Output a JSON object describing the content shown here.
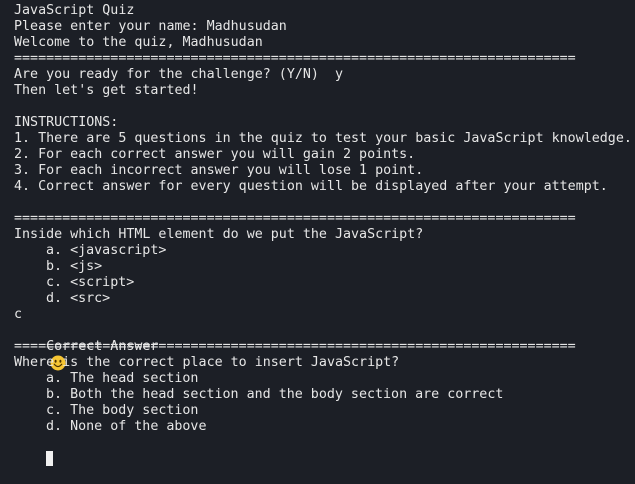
{
  "terminal": {
    "lines": {
      "title": "JavaScript Quiz",
      "name_prompt": "Please enter your name: Madhusudan",
      "welcome": "Welcome to the quiz, Madhusudan",
      "separator_1": "======================================================================",
      "ready_prompt": "Are you ready for the challenge? (Y/N)  y",
      "start": "Then let's get started!",
      "blank_1": "",
      "instructions_heading": "INSTRUCTIONS:",
      "instruction_1": "1. There are 5 questions in the quiz to test your basic JavaScript knowledge.",
      "instruction_2": "2. For each correct answer you will gain 2 points.",
      "instruction_3": "3. For each incorrect answer you will lose 1 point.",
      "instruction_4": "4. Correct answer for every question will be displayed after your attempt.",
      "blank_2": "",
      "separator_2": "======================================================================",
      "question_1": "Inside which HTML element do we put the JavaScript?",
      "q1_option_a": "a. <javascript>",
      "q1_option_b": "b. <js>",
      "q1_option_c": "c. <script>",
      "q1_option_d": "d. <src>",
      "answer_1": "c",
      "result_1": "Correct Answer",
      "separator_3": "======================================================================",
      "question_2": "Where is the correct place to insert JavaScript?",
      "q2_option_a": "a. The head section",
      "q2_option_b": "b. Both the head section and the body section are correct",
      "q2_option_c": "c. The body section",
      "q2_option_d": "d. None of the above"
    },
    "icons": {
      "result_emoji": "smiley-face-icon"
    },
    "colors": {
      "background": "#1c1f26",
      "text": "#e6e6e6",
      "emoji_fill": "#f6c533",
      "cursor": "#f0f0f0"
    }
  }
}
